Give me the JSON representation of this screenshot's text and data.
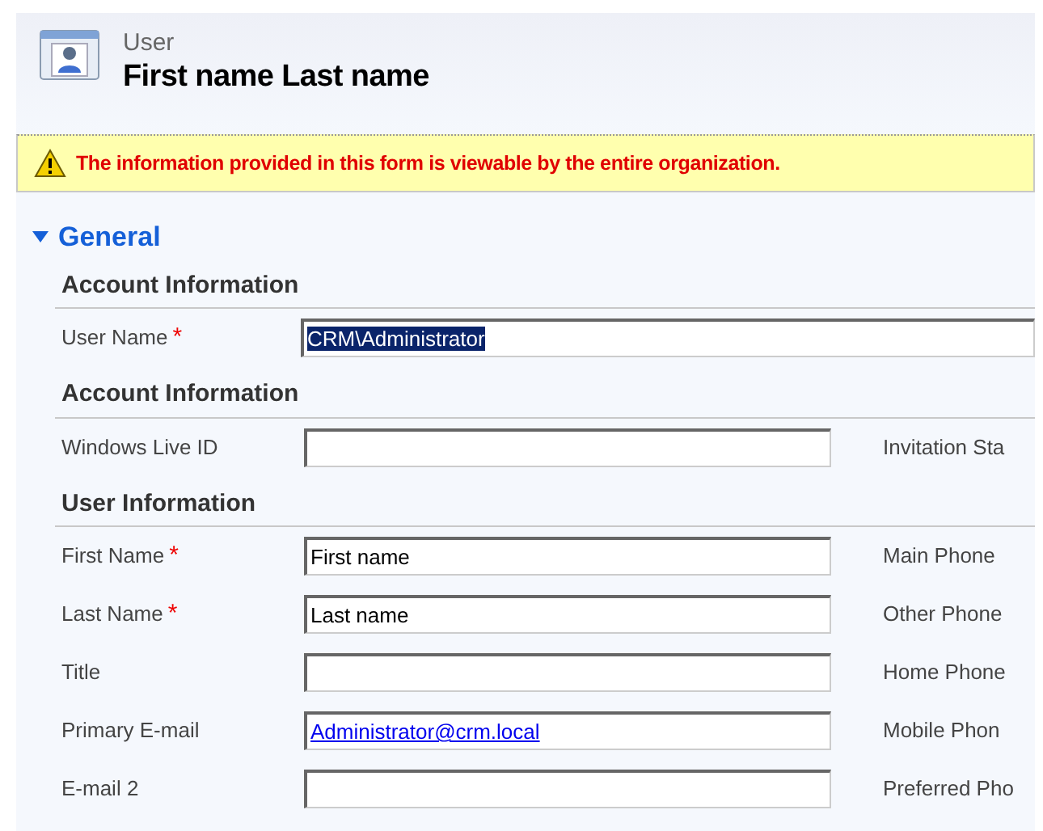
{
  "header": {
    "entity": "User",
    "title": "First name Last name"
  },
  "notification": {
    "kind": "warning",
    "text": "The information provided in this form is viewable by the entire organization."
  },
  "section": {
    "title": "General",
    "expanded": true,
    "groups": [
      {
        "title": "Account Information",
        "fields": [
          {
            "label": "User Name",
            "required_mark": "*",
            "kind": "text",
            "value": "CRM\\Administrator",
            "value_selected": true,
            "wide": true
          }
        ]
      },
      {
        "title": "Account Information",
        "fields": [
          {
            "label": "Windows Live ID",
            "kind": "text",
            "wide": false,
            "side_label": "Invitation Sta"
          }
        ]
      },
      {
        "title": "User Information",
        "fields": [
          {
            "label": "First Name",
            "required_mark": "*",
            "kind": "text",
            "value": "First name",
            "wide": false,
            "side_label": "Main Phone"
          },
          {
            "label": "Last Name",
            "required_mark": "*",
            "kind": "text",
            "value": "Last name",
            "wide": false,
            "side_label": "Other Phone"
          },
          {
            "label": "Title",
            "kind": "text",
            "wide": false,
            "side_label": "Home Phone"
          },
          {
            "label": "Primary E-mail",
            "kind": "link",
            "value": "Administrator@crm.local",
            "wide": false,
            "side_label": "Mobile Phon"
          },
          {
            "label": "E-mail 2",
            "kind": "text",
            "wide": false,
            "side_label": "Preferred Pho"
          }
        ]
      }
    ]
  }
}
